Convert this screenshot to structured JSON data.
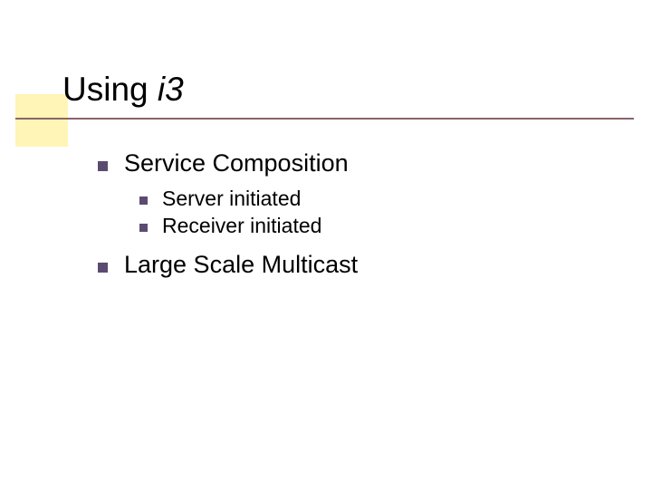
{
  "slide": {
    "title_prefix": "Using ",
    "title_italic": "i3",
    "items": [
      {
        "label": "Service Composition",
        "children": [
          {
            "label": "Server initiated"
          },
          {
            "label": "Receiver initiated"
          }
        ]
      },
      {
        "label": "Large Scale Multicast",
        "children": []
      }
    ]
  }
}
